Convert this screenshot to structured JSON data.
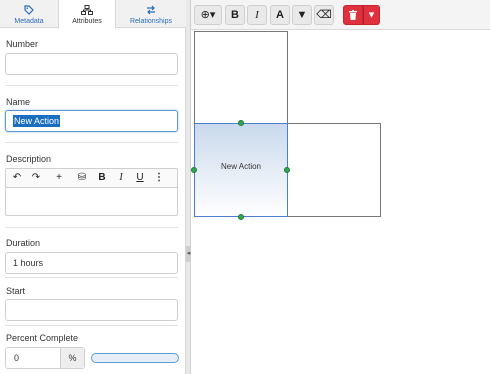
{
  "tabs": [
    {
      "label": "Metadata",
      "icon": "tag-icon"
    },
    {
      "label": "Attributes",
      "icon": "network-icon"
    },
    {
      "label": "Relationships",
      "icon": "swap-icon"
    }
  ],
  "form": {
    "number": {
      "label": "Number",
      "value": ""
    },
    "name": {
      "label": "Name",
      "value": "New Action"
    },
    "description": {
      "label": "Description",
      "value": ""
    },
    "duration": {
      "label": "Duration",
      "value": "1 hours"
    },
    "start": {
      "label": "Start",
      "value": ""
    },
    "percent_complete": {
      "label": "Percent Complete",
      "value": "0",
      "unit": "%",
      "progress": 0
    }
  },
  "rte_toolbar": [
    "↶",
    "↷",
    "+",
    "⛁",
    "B",
    "I",
    "U",
    "⋮"
  ],
  "toolbar": {
    "add_label": "⊕▾",
    "bold": "B",
    "italic": "I",
    "font_color": "A",
    "filter": "▼",
    "eraser": "⌫",
    "delete": "🗑",
    "more": "▾",
    "accent_color": "#e0313e"
  },
  "canvas": {
    "selected_cell_label": "New Action"
  }
}
